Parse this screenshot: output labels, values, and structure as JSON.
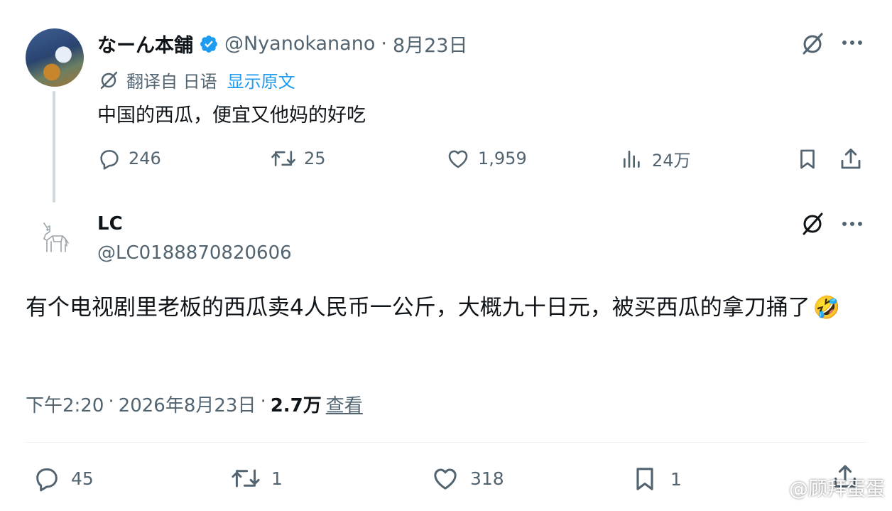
{
  "original_tweet": {
    "author_name": "なーん本舗",
    "handle": "@Nyanokanano",
    "separator": "·",
    "date": "8月23日",
    "translation_label": "翻译自 日语",
    "show_original_link": "显示原文",
    "text": "中国的西瓜，便宜又他妈的好吃",
    "replies": "246",
    "retweets": "25",
    "likes": "1,959",
    "views": "24万",
    "icons": [
      "grok-icon",
      "more-icon",
      "translate-icon",
      "reply-icon",
      "retweet-icon",
      "like-icon",
      "views-icon",
      "bookmark-icon",
      "share-icon"
    ]
  },
  "reply_tweet": {
    "author_name": "LC",
    "handle": "@LC0188870820606",
    "text": "有个电视剧里老板的西瓜卖4人民币一公斤，大概九十日元，被买西瓜的拿刀捅了",
    "emoji": "🤣",
    "time": "下午2:20",
    "separator1": "·",
    "date": "2026年8月23日",
    "separator2": "·",
    "views_count": "2.7万",
    "views_link": "查看",
    "replies": "45",
    "retweets": "1",
    "likes": "318",
    "bookmarks": "1",
    "icons": [
      "horse-avatar-icon",
      "grok-icon",
      "more-icon",
      "reply-icon",
      "retweet-icon",
      "like-icon",
      "bookmark-icon",
      "share-icon"
    ]
  },
  "watermark": "@顾拜蛋蛋",
  "colors": {
    "text": "#0f1419",
    "muted": "#536471",
    "link": "#1d9bf0",
    "verified": "#1d9bf0"
  }
}
